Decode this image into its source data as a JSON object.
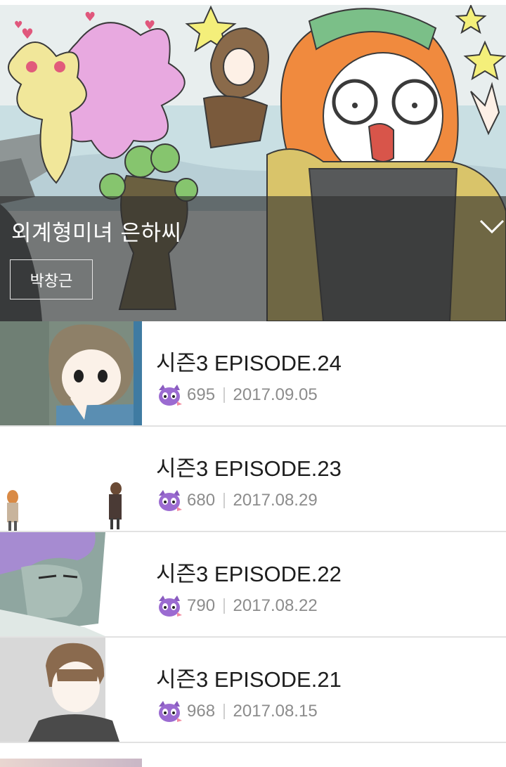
{
  "hero": {
    "title": "외계형미녀 은하씨",
    "author": "박창근"
  },
  "episodes": [
    {
      "title": "시즌3 EPISODE.24",
      "rating": "695",
      "date": "2017.09.05",
      "thumb": "boy-hand-on-chin"
    },
    {
      "title": "시즌3 EPISODE.23",
      "rating": "680",
      "date": "2017.08.29",
      "thumb": "two-small-figures"
    },
    {
      "title": "시즌3 EPISODE.22",
      "rating": "790",
      "date": "2017.08.22",
      "thumb": "purple-hair-face"
    },
    {
      "title": "시즌3 EPISODE.21",
      "rating": "968",
      "date": "2017.08.15",
      "thumb": "brown-hair-boy"
    }
  ],
  "icons": {
    "rating": "purple-cat-mascot-icon",
    "collapse": "chevron-down-icon"
  },
  "colors": {
    "overlay": "#2d2d2d",
    "title_text": "#1d1d1d",
    "meta_text": "#8c8c8c",
    "divider": "#e2e2e2"
  }
}
